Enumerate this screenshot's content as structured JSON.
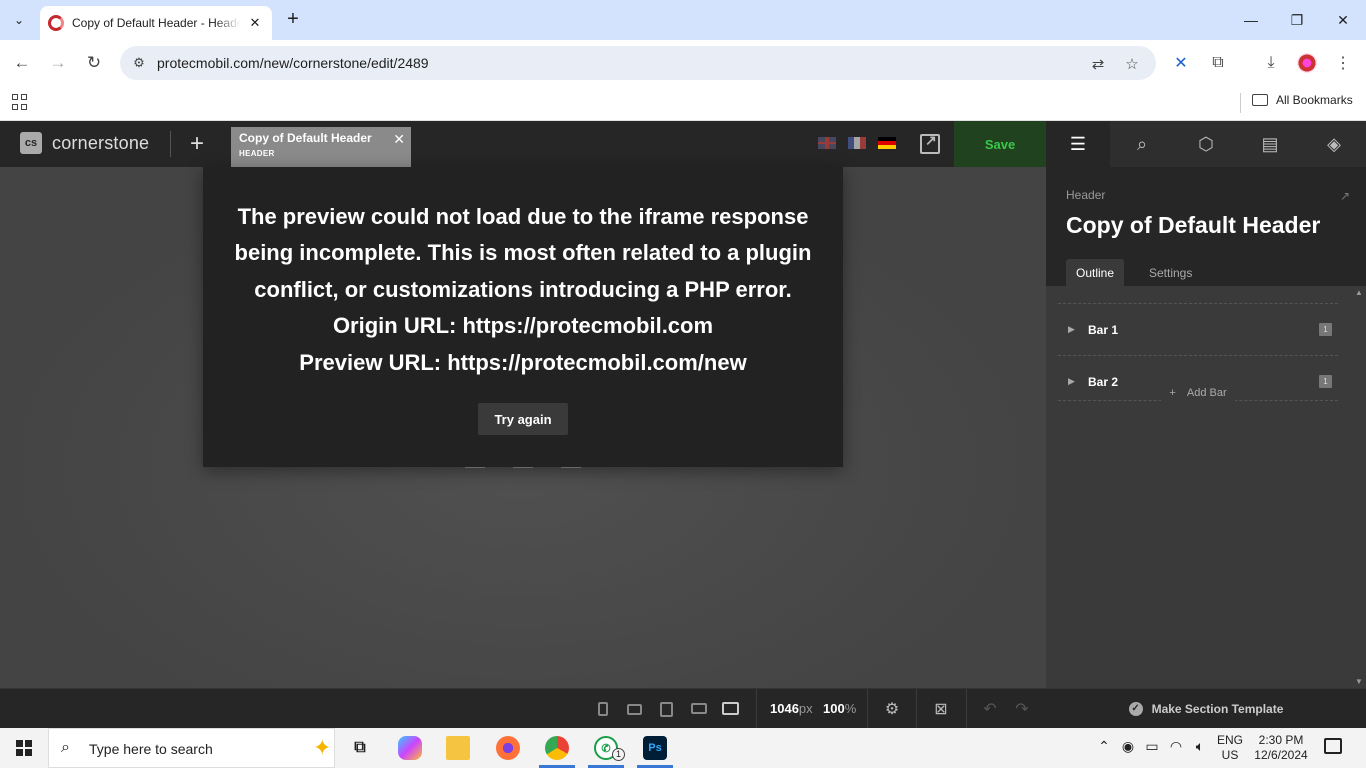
{
  "browser": {
    "tab_title": "Copy of Default Header - Header",
    "url": "protecmobil.com/new/cornerstone/edit/2489",
    "bookmarks_label": "All Bookmarks"
  },
  "app": {
    "logo_mark": "cs",
    "logo_text": "cornerstone",
    "doc_tab": {
      "title": "Copy of Default Header",
      "subtitle": "HEADER"
    },
    "save_label": "Save",
    "languages": [
      "en",
      "fr",
      "de"
    ]
  },
  "preview_error": {
    "lines": [
      "The preview could not load due to the iframe response",
      "being incomplete. This is most often related to a plugin",
      "conflict, or customizations introducing a PHP error.",
      "Origin URL: https://protecmobil.com",
      "Preview URL: https://protecmobil.com/new"
    ],
    "button_label": "Try again"
  },
  "bottom_bar": {
    "width_value": "1046",
    "width_unit": "px",
    "zoom_value": "100",
    "zoom_unit": "%"
  },
  "panel": {
    "type_label": "Header",
    "title": "Copy of Default Header",
    "tabs": [
      "Outline",
      "Settings"
    ],
    "active_tab": "Outline",
    "outline_items": [
      {
        "label": "Bar 1",
        "count": "1"
      },
      {
        "label": "Bar 2",
        "count": "1"
      }
    ],
    "add_bar_label": "Add Bar",
    "footer_label": "Make Section Template"
  },
  "taskbar": {
    "search_placeholder": "Type here to search",
    "whatsapp_badge": "1",
    "photoshop_label": "Ps",
    "lang_line1": "ENG",
    "lang_line2": "US",
    "time": "2:30 PM",
    "date": "12/6/2024"
  },
  "colors": {
    "save_bg": "#20421e",
    "save_text": "#39c84a",
    "app_dark": "#262626",
    "canvas": "#494949"
  }
}
